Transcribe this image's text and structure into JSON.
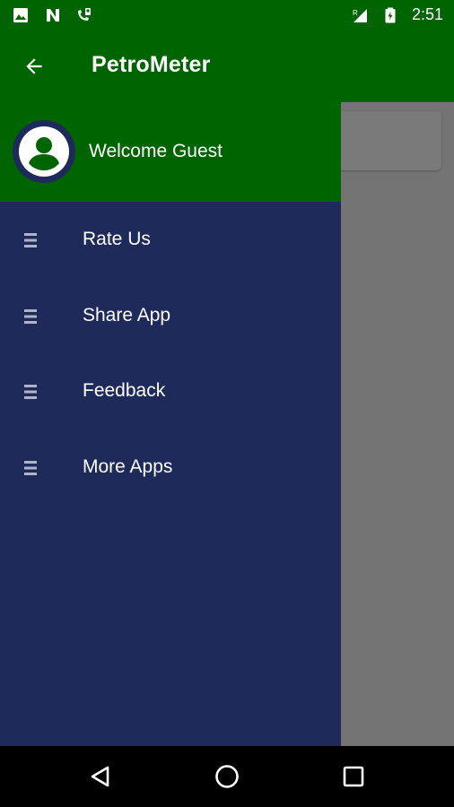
{
  "status_bar": {
    "time": "2:51",
    "icons": [
      "image-icon",
      "n-notification-icon",
      "missed-call-icon",
      "roaming-signal-icon",
      "battery-charging-icon"
    ]
  },
  "app_bar": {
    "title": "PetroMeter",
    "back_icon": "arrow-back-icon"
  },
  "drawer": {
    "welcome_text": "Welcome Guest",
    "avatar_icon": "account-circle-icon",
    "items": [
      {
        "label": "Rate Us",
        "icon": "menu-lines-icon"
      },
      {
        "label": "Share App",
        "icon": "menu-lines-icon"
      },
      {
        "label": "Feedback",
        "icon": "menu-lines-icon"
      },
      {
        "label": "More Apps",
        "icon": "menu-lines-icon"
      }
    ]
  },
  "nav_bar": {
    "buttons": [
      "back-triangle-icon",
      "home-circle-icon",
      "recents-square-icon"
    ]
  },
  "colors": {
    "primary_green": "#006400",
    "drawer_navy": "#1e2a5a",
    "scrim_gray": "#747474"
  }
}
